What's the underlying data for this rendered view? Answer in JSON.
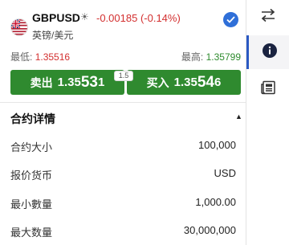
{
  "header": {
    "symbol": "GBPUSD",
    "change": "-0.00185",
    "change_pct": "(-0.14%)",
    "description": "英镑/美元",
    "low_label": "最低:",
    "low_value": "1.35516",
    "high_label": "最高:",
    "high_value": "1.35799"
  },
  "trade": {
    "spread": "1.5",
    "sell_label": "卖出",
    "sell_price_prefix": "1.35",
    "sell_price_big": "53",
    "sell_price_suffix": "1",
    "buy_label": "买入",
    "buy_price_prefix": "1.35",
    "buy_price_big": "54",
    "buy_price_suffix": "6"
  },
  "details": {
    "title": "合约详情",
    "rows": [
      {
        "label": "合约大小",
        "value": "100,000"
      },
      {
        "label": "报价货币",
        "value": "USD"
      },
      {
        "label": "最小數量",
        "value": "1,000.00"
      },
      {
        "label": "最大数量",
        "value": "30,000,000"
      }
    ]
  },
  "rail": {
    "icons": [
      "swap-arrows-icon",
      "info-icon",
      "news-icon"
    ]
  },
  "colors": {
    "accent_blue": "#2f6fd8",
    "button_green": "#2f8a2f",
    "negative_red": "#d32f2f",
    "positive_green": "#2e8b2e"
  }
}
